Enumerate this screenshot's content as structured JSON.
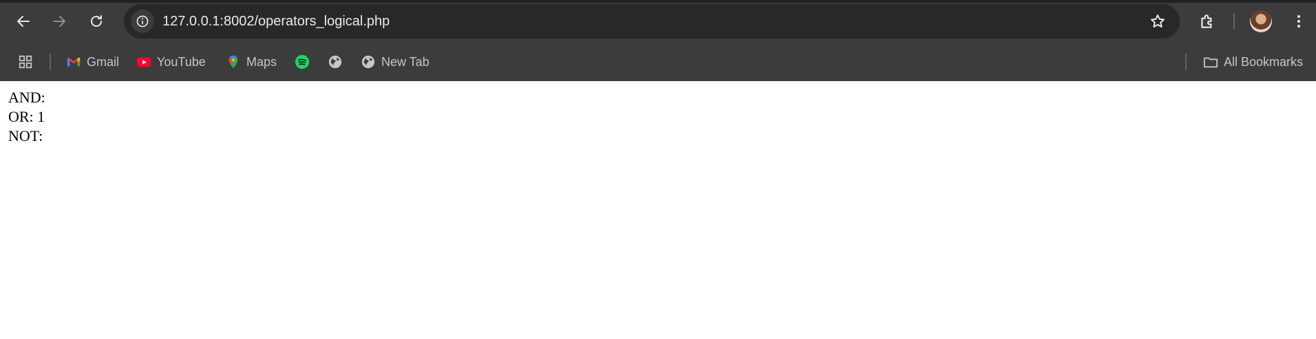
{
  "browser": {
    "url": "127.0.0.1:8002/operators_logical.php",
    "bookmarks": [
      {
        "label": "Gmail",
        "icon": "gmail-icon"
      },
      {
        "label": "YouTube",
        "icon": "youtube-icon"
      },
      {
        "label": "Maps",
        "icon": "maps-icon"
      },
      {
        "label": "",
        "icon": "spotify-icon"
      },
      {
        "label": "",
        "icon": "globe-icon"
      },
      {
        "label": "New Tab",
        "icon": "globe-icon"
      }
    ],
    "all_bookmarks_label": "All Bookmarks"
  },
  "page": {
    "lines": [
      "AND:",
      "OR: 1",
      "NOT:"
    ]
  }
}
